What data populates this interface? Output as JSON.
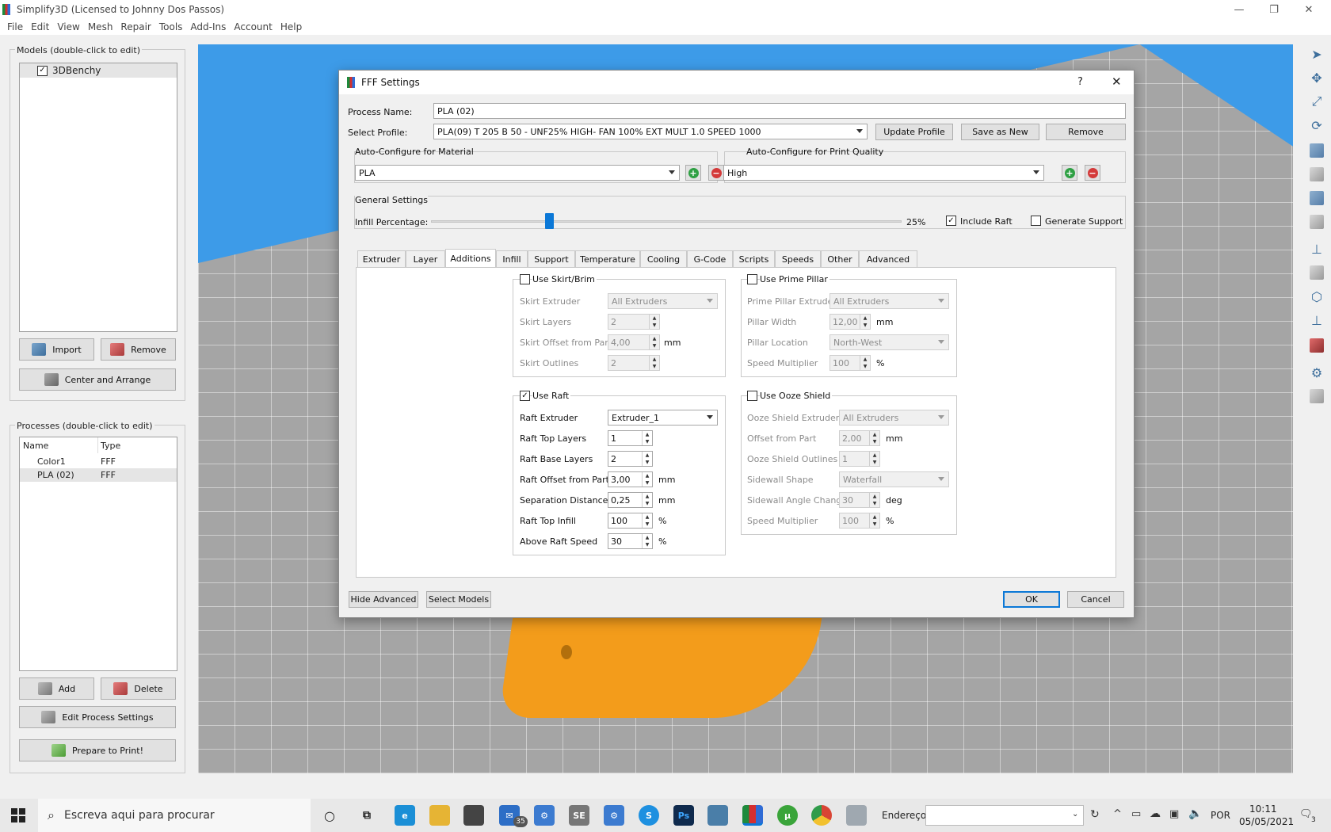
{
  "app": {
    "title": "Simplify3D (Licensed to Johnny Dos Passos)"
  },
  "menu": [
    "File",
    "Edit",
    "View",
    "Mesh",
    "Repair",
    "Tools",
    "Add-Ins",
    "Account",
    "Help"
  ],
  "models": {
    "title": "Models (double-click to edit)",
    "items": [
      {
        "label": "3DBenchy",
        "checked": true
      }
    ],
    "import_label": "Import",
    "remove_label": "Remove",
    "center_label": "Center and Arrange"
  },
  "processes": {
    "title": "Processes (double-click to edit)",
    "col_name": "Name",
    "col_type": "Type",
    "rows": [
      {
        "name": "Color1",
        "type": "FFF"
      },
      {
        "name": "PLA (02)",
        "type": "FFF"
      }
    ],
    "add_label": "Add",
    "delete_label": "Delete",
    "edit_label": "Edit Process Settings",
    "prepare_label": "Prepare to Print!"
  },
  "dialog": {
    "title": "FFF Settings",
    "help": "?",
    "close": "✕",
    "process_name_label": "Process Name:",
    "process_name": "PLA (02)",
    "select_profile_label": "Select Profile:",
    "profile": "PLA(09) T 205 B 50 - UNF25% HIGH- FAN 100% EXT MULT 1.0 SPEED 1000",
    "update_profile": "Update Profile",
    "save_as_new": "Save as New",
    "remove": "Remove",
    "material_title": "Auto-Configure for Material",
    "material": "PLA",
    "quality_title": "Auto-Configure for Print Quality",
    "quality": "High",
    "general_title": "General Settings",
    "infill_label": "Infill Percentage:",
    "infill_value": "25%",
    "infill_fraction": 0.25,
    "include_raft": "Include Raft",
    "generate_support": "Generate Support",
    "tabs": [
      "Extruder",
      "Layer",
      "Additions",
      "Infill",
      "Support",
      "Temperature",
      "Cooling",
      "G-Code",
      "Scripts",
      "Speeds",
      "Other",
      "Advanced"
    ],
    "skirt": {
      "title": "Use Skirt/Brim",
      "extruder_label": "Skirt Extruder",
      "extruder": "All Extruders",
      "layers_label": "Skirt Layers",
      "layers": "2",
      "offset_label": "Skirt Offset from Part",
      "offset": "4,00",
      "offset_unit": "mm",
      "outlines_label": "Skirt Outlines",
      "outlines": "2"
    },
    "prime": {
      "title": "Use Prime Pillar",
      "extruder_label": "Prime Pillar Extruder",
      "extruder": "All Extruders",
      "width_label": "Pillar Width",
      "width": "12,00",
      "width_unit": "mm",
      "location_label": "Pillar Location",
      "location": "North-West",
      "speed_label": "Speed Multiplier",
      "speed": "100",
      "speed_unit": "%"
    },
    "raft": {
      "title": "Use Raft",
      "extruder_label": "Raft Extruder",
      "extruder": "Extruder_1",
      "top_layers_label": "Raft Top Layers",
      "top_layers": "1",
      "base_layers_label": "Raft Base Layers",
      "base_layers": "2",
      "offset_label": "Raft Offset from Part",
      "offset": "3,00",
      "offset_unit": "mm",
      "sep_label": "Separation Distance",
      "sep": "0,25",
      "sep_unit": "mm",
      "infill_label": "Raft Top Infill",
      "infill": "100",
      "infill_unit": "%",
      "speed_label": "Above Raft Speed",
      "speed": "30",
      "speed_unit": "%"
    },
    "ooze": {
      "title": "Use Ooze Shield",
      "extruder_label": "Ooze Shield Extruder",
      "extruder": "All Extruders",
      "offset_label": "Offset from Part",
      "offset": "2,00",
      "offset_unit": "mm",
      "outlines_label": "Ooze Shield Outlines",
      "outlines": "1",
      "shape_label": "Sidewall Shape",
      "shape": "Waterfall",
      "angle_label": "Sidewall Angle Change",
      "angle": "30",
      "angle_unit": "deg",
      "speed_label": "Speed Multiplier",
      "speed": "100",
      "speed_unit": "%"
    },
    "hide_advanced": "Hide Advanced",
    "select_models": "Select Models",
    "ok": "OK",
    "cancel": "Cancel"
  },
  "taskbar": {
    "search_placeholder": "Escreva aqui para procurar",
    "address_label": "Endereço",
    "lang": "POR",
    "time": "10:11",
    "date": "05/05/2021",
    "badge": "35",
    "notif": "3"
  }
}
